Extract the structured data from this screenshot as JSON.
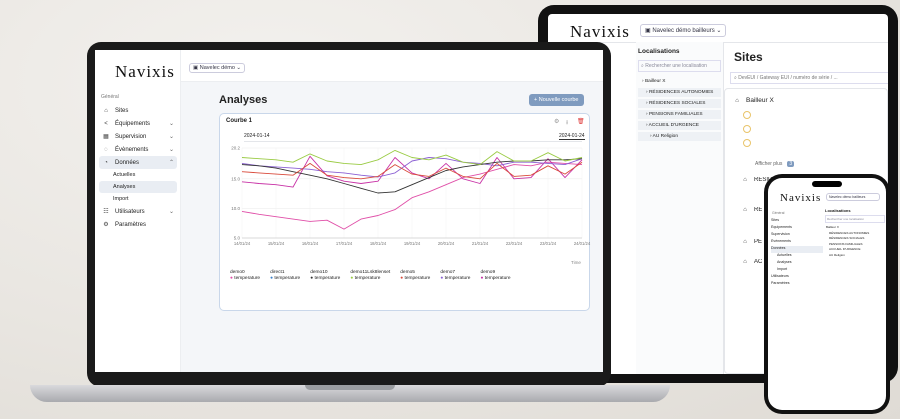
{
  "app": {
    "logo": "Navixis",
    "org_selector": "Navelec démo",
    "tablet_org_selector": "Navelec démo bailleurs"
  },
  "sidebar": {
    "section": "Général",
    "items": [
      {
        "label": "Sites",
        "icon": "home-icon"
      },
      {
        "label": "Équipements",
        "icon": "share-icon",
        "chevron": true
      },
      {
        "label": "Supervision",
        "icon": "grid-icon",
        "chevron": true
      },
      {
        "label": "Évènements",
        "icon": "bell-icon",
        "chevron": true
      },
      {
        "label": "Données",
        "icon": "chart-icon",
        "chevron": true,
        "open": true
      },
      {
        "label": "Utilisateurs",
        "icon": "users-icon",
        "chevron": true
      },
      {
        "label": "Paramètres",
        "icon": "gear-icon"
      }
    ],
    "sub_items": [
      "Actuelles",
      "Analyses",
      "Import"
    ]
  },
  "main": {
    "title": "Analyses",
    "new_curve_button": "+ Nouvelle courbe",
    "card": {
      "title": "Courbe 1",
      "date_start": "2024-01-14",
      "date_end": "2024-01-24",
      "time_label": "Time"
    }
  },
  "legend": [
    {
      "device": "demo0",
      "metric": "temperature",
      "color": "#e04fa8"
    },
    {
      "device": "direct1",
      "metric": "temperature",
      "color": "#3a7fc8"
    },
    {
      "device": "demo10",
      "metric": "temperature",
      "color": "#333333"
    },
    {
      "device": "demo11Lsk8lenset",
      "metric": "temperature",
      "color": "#9acb44"
    },
    {
      "device": "demo5",
      "metric": "temperature",
      "color": "#d94b3c"
    },
    {
      "device": "demo7",
      "metric": "temperature",
      "color": "#8b60d3"
    },
    {
      "device": "demo9",
      "metric": "temperature",
      "color": "#c832a6"
    }
  ],
  "chart_data": {
    "type": "line",
    "x": [
      "14/01/24",
      "15/01/24",
      "16/01/24",
      "17/01/24",
      "18/01/24",
      "19/01/24",
      "20/01/24",
      "21/01/24",
      "22/01/24",
      "23/01/24",
      "24/01/24"
    ],
    "yticks": [
      "5.0",
      "10.0",
      "15.0",
      "20.2"
    ],
    "ylim": [
      5,
      20.2
    ],
    "series": [
      {
        "name": "demo0 temperature",
        "color": "#e04fa8",
        "values": [
          9.5,
          9,
          8.6,
          8.2,
          7.8,
          8,
          6.5,
          8.2,
          8.8,
          9.8,
          11.8,
          12.8,
          14,
          15.2,
          15.8,
          16.6,
          17.4,
          17.2,
          17.8,
          17.6,
          17.4
        ]
      },
      {
        "name": "demo9 temperature",
        "color": "#c832a6",
        "values": [
          14.5,
          14.2,
          14,
          13.6,
          18.8,
          15.5,
          14.6,
          14.2,
          14.6,
          18.6,
          16,
          15,
          17.6,
          15,
          14.2,
          18.6,
          15,
          15.2,
          18.4,
          15.2,
          18.2
        ]
      },
      {
        "name": "demo7 temperature",
        "color": "#8b60d3",
        "values": [
          17.6,
          17.2,
          17,
          16.8,
          16.6,
          16.2,
          16,
          15.6,
          15.3,
          16,
          18,
          18.6,
          18.4,
          17.8,
          17.6,
          17.2,
          17.8,
          17.8,
          17.6,
          17.4,
          18.4
        ]
      },
      {
        "name": "demo10 temperature",
        "color": "#333333",
        "values": [
          17.4,
          17.2,
          16.8,
          16.2,
          15.6,
          15,
          14.2,
          13.4,
          12.6,
          12.8,
          14,
          15.2,
          16.4,
          17,
          17.4,
          17.8,
          18,
          18,
          18.2,
          18.2,
          18.4
        ]
      },
      {
        "name": "demo11Lsk8lenset temperature",
        "color": "#9acb44",
        "values": [
          18.6,
          18.4,
          18.2,
          17.8,
          19.2,
          18,
          17.6,
          17.4,
          18.2,
          19.8,
          18.6,
          18.2,
          19,
          17.8,
          17.4,
          19.6,
          18,
          18,
          19.4,
          18,
          18.6
        ]
      },
      {
        "name": "demo5 temperature",
        "color": "#d94b3c",
        "values": [
          16.2,
          16,
          15.8,
          15.6,
          17.6,
          15.6,
          15.2,
          15,
          15.4,
          17.4,
          15.8,
          15.4,
          16.8,
          15.4,
          15,
          17.6,
          15.4,
          15.6,
          17.2,
          15.8,
          17.8
        ]
      }
    ]
  },
  "tablet": {
    "locations_title": "Localisations",
    "search_placeholder": "Rechercher une localisation",
    "tree": [
      "Bailleur X",
      "RÉSIDENCES AUTONOMIES",
      "RÉSIDENCES SOCIALES",
      "PENSIONS FAMILIALES",
      "ACCUEIL D'URGENCE",
      "AU Religion"
    ],
    "sites_title": "Sites",
    "sites_search": "DevEUI / Gateway EUI / numéro de série / ...",
    "site_rows": [
      "Bailleur X",
      "RÉSIDENCES AUTONOMIES",
      "RE",
      "PE",
      "AC"
    ],
    "show_more": "Afficher plus",
    "show_more_count": "3"
  },
  "phone": {
    "logo": "Navixis",
    "org": "Navelec démo bailleurs",
    "section": "Général",
    "locations": "Localisations",
    "search": "Rechercher une localisation",
    "menu": [
      "Sites",
      "Équipements",
      "Supervision",
      "Évènements",
      "Données",
      "Actuelles",
      "Analyses",
      "Import",
      "Utilisateurs",
      "Paramètres"
    ],
    "tree": [
      "Bailleur X",
      "RÉSIDENCES AUTONOMIES",
      "RÉSIDENCES SOCIALES",
      "PENSIONS FAMILIALES",
      "ACCUEIL D'URGENCE",
      "AU Religion"
    ]
  }
}
